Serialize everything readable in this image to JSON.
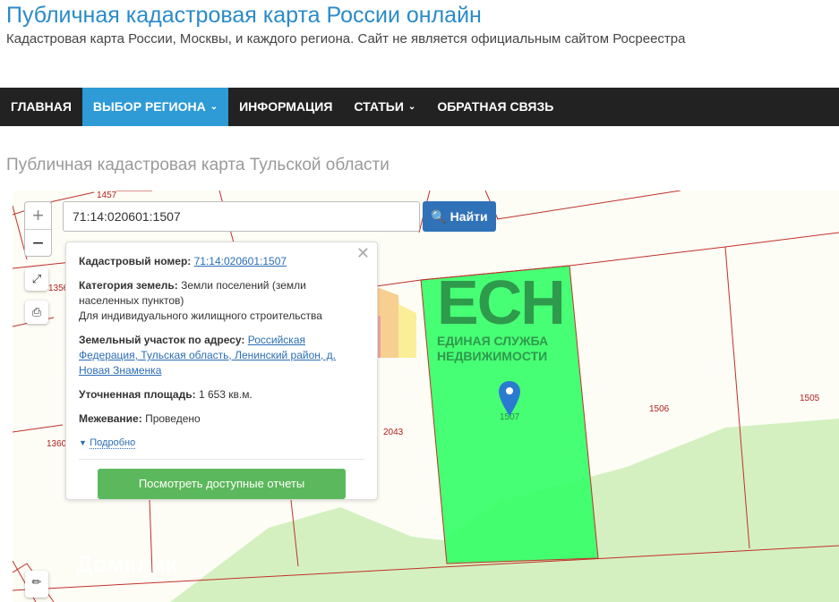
{
  "header": {
    "title": "Публичная кадастровая карта России онлайн",
    "subtitle": "Кадастровая карта России, Москвы, и каждого региона. Сайт не является официальным сайтом Росреестра"
  },
  "nav": [
    {
      "label": "ГЛАВНАЯ"
    },
    {
      "label": "ВЫБОР РЕГИОНА",
      "active": true,
      "dropdown": true
    },
    {
      "label": "ИНФОРМАЦИЯ"
    },
    {
      "label": "СТАТЬИ",
      "dropdown": true
    },
    {
      "label": "ОБРАТНАЯ СВЯЗЬ"
    }
  ],
  "page_title": "Публичная кадастровая карта Тульской области",
  "map": {
    "search_value": "71:14:020601:1507",
    "find_label": "Найти",
    "zoom_in": "+",
    "zoom_out": "−",
    "parcel_labels": [
      "1457",
      "1356",
      "1360",
      "2043",
      "1507",
      "1506",
      "1505"
    ],
    "watermark": "Домклик",
    "logo": {
      "big": "ЕСН",
      "line1": "ЕДИНАЯ СЛУЖБА",
      "line2": "НЕДВИЖИМОСТИ"
    },
    "colors": {
      "parcel": "#33ff66",
      "boundary": "#c0302a",
      "accent": "#2f72b8"
    }
  },
  "popup": {
    "cad_label": "Кадастровый номер:",
    "cad_value": "71:14:020601:1507",
    "cat_label": "Категория земель:",
    "cat_value": "Земли поселений (земли населенных пунктов)",
    "cat_use": "Для индивидуального жилищного строительства",
    "addr_label": "Земельный участок по адресу:",
    "addr_value": "Российская Федерация, Тульская область, Ленинский район, д. Новая Знаменка",
    "area_label": "Уточненная площадь:",
    "area_value": "1 653 кв.м.",
    "survey_label": "Межевание:",
    "survey_value": "Проведено",
    "more": "Подробно",
    "reports_button": "Посмотреть доступные отчеты"
  }
}
